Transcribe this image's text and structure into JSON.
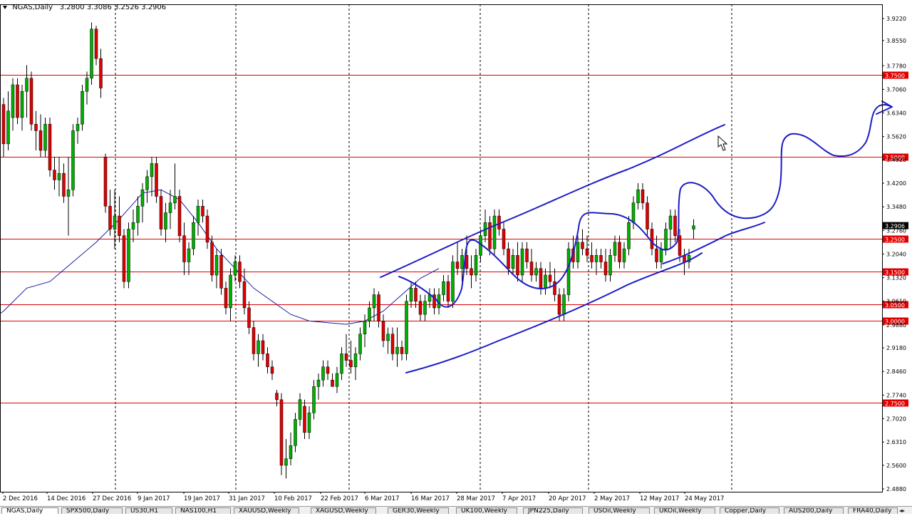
{
  "header": {
    "symbol": "NGAS,Daily",
    "ohlc": "3.2800 3.3086 3.2526 3.2906"
  },
  "colors": {
    "bull": "#00b000",
    "bear": "#e00000",
    "level": "#e00000",
    "ma": "#1c1ca0",
    "annotation": "#1c1cc8",
    "grid": "#000000",
    "current_price_bg": "#000000"
  },
  "chart_data": {
    "type": "candlestick",
    "instrument": "NGAS",
    "timeframe": "Daily",
    "y_axis_ticks": [
      "3.9220",
      "3.8550",
      "3.7780",
      "3.7060",
      "3.6340",
      "3.5620",
      "3.4920",
      "3.4200",
      "3.3480",
      "3.2760",
      "3.2040",
      "3.1320",
      "3.0610",
      "2.9880",
      "2.9180",
      "2.8460",
      "2.7740",
      "2.7020",
      "2.6310",
      "2.5600",
      "2.4880"
    ],
    "x_axis_labels": [
      "2 Dec 2016",
      "14 Dec 2016",
      "27 Dec 2016",
      "9 Jan 2017",
      "19 Jan 2017",
      "31 Jan 2017",
      "10 Feb 2017",
      "22 Feb 2017",
      "6 Mar 2017",
      "16 Mar 2017",
      "28 Mar 2017",
      "7 Apr 2017",
      "20 Apr 2017",
      "2 May 2017",
      "12 May 2017",
      "24 May 2017"
    ],
    "ylim": [
      2.488,
      3.922
    ],
    "grid": "vertical dotted separators",
    "horizontal_levels": [
      "3.7500",
      "3.5000",
      "3.2500",
      "3.1500",
      "3.0500",
      "3.0000",
      "2.7500"
    ],
    "current_price": "3.2906",
    "moving_average": [
      [
        -3,
        3.0
      ],
      [
        0,
        3.03
      ],
      [
        5,
        3.1
      ],
      [
        10,
        3.12
      ],
      [
        15,
        3.18
      ],
      [
        20,
        3.24
      ],
      [
        25,
        3.31
      ],
      [
        30,
        3.39
      ],
      [
        34,
        3.4
      ],
      [
        38,
        3.37
      ],
      [
        42,
        3.3
      ],
      [
        46,
        3.22
      ],
      [
        50,
        3.16
      ],
      [
        54,
        3.1
      ],
      [
        58,
        3.06
      ],
      [
        62,
        3.02
      ],
      [
        66,
        3.0
      ],
      [
        70,
        2.995
      ],
      [
        74,
        2.99
      ],
      [
        78,
        3.0
      ],
      [
        82,
        3.03
      ],
      [
        86,
        3.08
      ],
      [
        90,
        3.13
      ],
      [
        94,
        3.16
      ]
    ],
    "candles": [
      [
        3.66,
        3.68,
        3.5,
        3.54
      ],
      [
        3.54,
        3.7,
        3.52,
        3.64
      ],
      [
        3.62,
        3.74,
        3.58,
        3.72
      ],
      [
        3.72,
        3.74,
        3.6,
        3.62
      ],
      [
        3.62,
        3.72,
        3.58,
        3.7
      ],
      [
        3.7,
        3.78,
        3.62,
        3.74
      ],
      [
        3.74,
        3.76,
        3.58,
        3.6
      ],
      [
        3.6,
        3.64,
        3.52,
        3.58
      ],
      [
        3.58,
        3.63,
        3.5,
        3.52
      ],
      [
        3.52,
        3.62,
        3.5,
        3.6
      ],
      [
        3.6,
        3.62,
        3.44,
        3.46
      ],
      [
        3.46,
        3.5,
        3.4,
        3.43
      ],
      [
        3.43,
        3.5,
        3.38,
        3.45
      ],
      [
        3.45,
        3.48,
        3.36,
        3.38
      ],
      [
        3.38,
        3.5,
        3.26,
        3.4
      ],
      [
        3.4,
        3.6,
        3.38,
        3.58
      ],
      [
        3.58,
        3.62,
        3.54,
        3.6
      ],
      [
        3.6,
        3.72,
        3.58,
        3.7
      ],
      [
        3.7,
        3.76,
        3.66,
        3.74
      ],
      [
        3.74,
        3.91,
        3.72,
        3.89
      ],
      [
        3.89,
        3.9,
        3.78,
        3.8
      ],
      [
        3.8,
        3.83,
        3.68,
        3.71
      ],
      [
        3.5,
        3.51,
        3.33,
        3.35
      ],
      [
        3.35,
        3.4,
        3.26,
        3.28
      ],
      [
        3.28,
        3.4,
        3.22,
        3.32
      ],
      [
        3.32,
        3.38,
        3.24,
        3.26
      ],
      [
        3.26,
        3.28,
        3.1,
        3.12
      ],
      [
        3.12,
        3.3,
        3.1,
        3.28
      ],
      [
        3.28,
        3.34,
        3.24,
        3.3
      ],
      [
        3.3,
        3.38,
        3.26,
        3.35
      ],
      [
        3.35,
        3.42,
        3.3,
        3.4
      ],
      [
        3.4,
        3.46,
        3.36,
        3.44
      ],
      [
        3.44,
        3.5,
        3.38,
        3.48
      ],
      [
        3.48,
        3.5,
        3.36,
        3.38
      ],
      [
        3.38,
        3.4,
        3.26,
        3.28
      ],
      [
        3.28,
        3.36,
        3.24,
        3.33
      ],
      [
        3.33,
        3.4,
        3.28,
        3.36
      ],
      [
        3.36,
        3.48,
        3.34,
        3.38
      ],
      [
        3.38,
        3.4,
        3.24,
        3.26
      ],
      [
        3.26,
        3.3,
        3.14,
        3.18
      ],
      [
        3.18,
        3.24,
        3.14,
        3.22
      ],
      [
        3.22,
        3.32,
        3.2,
        3.3
      ],
      [
        3.3,
        3.37,
        3.26,
        3.35
      ],
      [
        3.35,
        3.37,
        3.3,
        3.32
      ],
      [
        3.32,
        3.34,
        3.22,
        3.24
      ],
      [
        3.24,
        3.26,
        3.12,
        3.14
      ],
      [
        3.14,
        3.22,
        3.1,
        3.2
      ],
      [
        3.2,
        3.22,
        3.08,
        3.1
      ],
      [
        3.1,
        3.12,
        3.02,
        3.04
      ],
      [
        3.04,
        3.16,
        3.0,
        3.14
      ],
      [
        3.14,
        3.2,
        3.12,
        3.18
      ],
      [
        3.18,
        3.2,
        3.1,
        3.12
      ],
      [
        3.12,
        3.16,
        3.02,
        3.04
      ],
      [
        3.04,
        3.06,
        2.96,
        2.98
      ],
      [
        2.98,
        3.0,
        2.88,
        2.9
      ],
      [
        2.9,
        2.96,
        2.86,
        2.94
      ],
      [
        2.94,
        2.96,
        2.88,
        2.9
      ],
      [
        2.9,
        2.92,
        2.84,
        2.86
      ],
      [
        2.86,
        2.88,
        2.82,
        2.84
      ],
      [
        2.78,
        2.79,
        2.74,
        2.76
      ],
      [
        2.76,
        2.78,
        2.53,
        2.56
      ],
      [
        2.56,
        2.64,
        2.52,
        2.58
      ],
      [
        2.58,
        2.66,
        2.56,
        2.62
      ],
      [
        2.62,
        2.72,
        2.6,
        2.7
      ],
      [
        2.7,
        2.78,
        2.68,
        2.76
      ],
      [
        2.74,
        2.76,
        2.64,
        2.66
      ],
      [
        2.66,
        2.74,
        2.64,
        2.72
      ],
      [
        2.72,
        2.82,
        2.7,
        2.8
      ],
      [
        2.8,
        2.84,
        2.76,
        2.82
      ],
      [
        2.82,
        2.88,
        2.8,
        2.86
      ],
      [
        2.86,
        2.88,
        2.82,
        2.84
      ],
      [
        2.82,
        2.84,
        2.8,
        2.8
      ],
      [
        2.8,
        2.86,
        2.78,
        2.84
      ],
      [
        2.84,
        2.92,
        2.82,
        2.9
      ],
      [
        2.9,
        2.96,
        2.86,
        2.88
      ],
      [
        2.88,
        2.94,
        2.84,
        2.86
      ],
      [
        2.86,
        2.92,
        2.82,
        2.9
      ],
      [
        2.9,
        2.98,
        2.88,
        2.96
      ],
      [
        2.96,
        3.02,
        2.92,
        3.0
      ],
      [
        3.0,
        3.06,
        2.98,
        3.04
      ],
      [
        3.04,
        3.1,
        3.0,
        3.08
      ],
      [
        3.08,
        3.09,
        2.98,
        3.0
      ],
      [
        3.0,
        3.02,
        2.92,
        2.94
      ],
      [
        2.94,
        2.98,
        2.9,
        2.96
      ],
      [
        2.96,
        2.98,
        2.88,
        2.9
      ],
      [
        2.9,
        2.98,
        2.86,
        2.92
      ],
      [
        2.92,
        2.94,
        2.88,
        2.9
      ],
      [
        2.9,
        3.08,
        2.88,
        3.06
      ],
      [
        3.06,
        3.12,
        3.04,
        3.1
      ],
      [
        3.1,
        3.12,
        3.04,
        3.06
      ],
      [
        3.06,
        3.08,
        3.0,
        3.02
      ],
      [
        3.02,
        3.08,
        3.0,
        3.06
      ],
      [
        3.06,
        3.1,
        3.04,
        3.08
      ],
      [
        3.08,
        3.1,
        3.02,
        3.04
      ],
      [
        3.04,
        3.1,
        3.02,
        3.08
      ],
      [
        3.08,
        3.14,
        3.06,
        3.12
      ],
      [
        3.12,
        3.14,
        3.04,
        3.06
      ],
      [
        3.06,
        3.2,
        3.04,
        3.18
      ],
      [
        3.18,
        3.24,
        3.14,
        3.16
      ],
      [
        3.16,
        3.22,
        3.12,
        3.2
      ],
      [
        3.2,
        3.26,
        3.14,
        3.16
      ],
      [
        3.16,
        3.2,
        3.1,
        3.14
      ],
      [
        3.14,
        3.22,
        3.12,
        3.2
      ],
      [
        3.2,
        3.28,
        3.18,
        3.26
      ],
      [
        3.26,
        3.34,
        3.24,
        3.3
      ],
      [
        3.3,
        3.32,
        3.2,
        3.22
      ],
      [
        3.22,
        3.34,
        3.2,
        3.32
      ],
      [
        3.32,
        3.34,
        3.26,
        3.28
      ],
      [
        3.28,
        3.3,
        3.2,
        3.22
      ],
      [
        3.22,
        3.24,
        3.14,
        3.16
      ],
      [
        3.16,
        3.22,
        3.14,
        3.2
      ],
      [
        3.2,
        3.24,
        3.12,
        3.14
      ],
      [
        3.14,
        3.24,
        3.12,
        3.22
      ],
      [
        3.22,
        3.24,
        3.16,
        3.18
      ],
      [
        3.18,
        3.22,
        3.12,
        3.14
      ],
      [
        3.14,
        3.18,
        3.12,
        3.16
      ],
      [
        3.16,
        3.18,
        3.08,
        3.1
      ],
      [
        3.1,
        3.16,
        3.08,
        3.14
      ],
      [
        3.14,
        3.18,
        3.1,
        3.12
      ],
      [
        3.12,
        3.16,
        3.06,
        3.08
      ],
      [
        3.08,
        3.1,
        3.0,
        3.02
      ],
      [
        3.02,
        3.1,
        3.0,
        3.08
      ],
      [
        3.08,
        3.24,
        3.06,
        3.22
      ],
      [
        3.22,
        3.26,
        3.16,
        3.18
      ],
      [
        3.18,
        3.26,
        3.16,
        3.24
      ],
      [
        3.24,
        3.28,
        3.2,
        3.22
      ],
      [
        3.22,
        3.26,
        3.18,
        3.2
      ],
      [
        3.2,
        3.24,
        3.16,
        3.18
      ],
      [
        3.18,
        3.22,
        3.14,
        3.2
      ],
      [
        3.2,
        3.22,
        3.16,
        3.18
      ],
      [
        3.18,
        3.22,
        3.12,
        3.14
      ],
      [
        3.14,
        3.22,
        3.12,
        3.2
      ],
      [
        3.2,
        3.26,
        3.18,
        3.24
      ],
      [
        3.24,
        3.26,
        3.16,
        3.18
      ],
      [
        3.18,
        3.24,
        3.16,
        3.22
      ],
      [
        3.22,
        3.32,
        3.2,
        3.3
      ],
      [
        3.3,
        3.38,
        3.28,
        3.36
      ],
      [
        3.36,
        3.42,
        3.34,
        3.4
      ],
      [
        3.4,
        3.42,
        3.34,
        3.36
      ],
      [
        3.36,
        3.38,
        3.26,
        3.28
      ],
      [
        3.28,
        3.3,
        3.2,
        3.22
      ],
      [
        3.22,
        3.26,
        3.16,
        3.18
      ],
      [
        3.18,
        3.24,
        3.16,
        3.22
      ],
      [
        3.22,
        3.3,
        3.2,
        3.28
      ],
      [
        3.28,
        3.34,
        3.22,
        3.32
      ],
      [
        3.32,
        3.34,
        3.24,
        3.26
      ],
      [
        3.26,
        3.28,
        3.18,
        3.2
      ],
      [
        3.2,
        3.22,
        3.14,
        3.18
      ],
      [
        3.18,
        3.22,
        3.16,
        3.2
      ],
      [
        3.28,
        3.31,
        3.25,
        3.29
      ]
    ]
  },
  "tabs": [
    {
      "label": "NGAS,Daily"
    },
    {
      "label": "SPX500,Daily"
    },
    {
      "label": "US30,H1"
    },
    {
      "label": "NAS100,H1"
    },
    {
      "label": "XAUUSD,Weekly"
    },
    {
      "label": "XAGUSD,Weekly"
    },
    {
      "label": "GER30,Weekly"
    },
    {
      "label": "UK100,Weekly"
    },
    {
      "label": "JPN225,Daily"
    },
    {
      "label": "USOil,Weekly"
    },
    {
      "label": "UKOil,Weekly"
    },
    {
      "label": "Copper,Daily"
    },
    {
      "label": "AUS200,Daily"
    },
    {
      "label": "FRA40,Daily"
    }
  ]
}
